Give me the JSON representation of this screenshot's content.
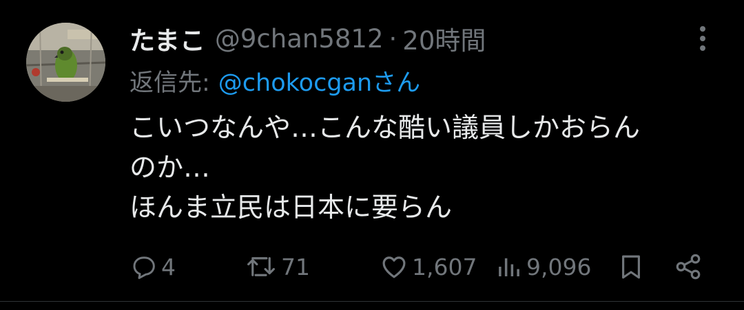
{
  "tweet": {
    "display_name": "たまこ",
    "handle": "@9chan5812",
    "separator": "·",
    "time": "20時間",
    "reply_label": "返信先:",
    "reply_to": "@chokocganさん",
    "body_lines": [
      "こいつなんや…こんな酷い議員しかおらん",
      "のか…",
      "ほんま立民は日本に要らん"
    ]
  },
  "actions": {
    "replies": "4",
    "retweets": "71",
    "likes": "1,607",
    "views": "9,096"
  },
  "icons": {
    "more": "more-horizontal-icon",
    "reply": "reply-bubble-icon",
    "retweet": "retweet-icon",
    "like": "heart-icon",
    "views": "analytics-bars-icon",
    "bookmark": "bookmark-icon",
    "share": "share-icon"
  },
  "colors": {
    "background": "#000000",
    "text_primary": "#e7e9ea",
    "text_secondary": "#71767b",
    "link": "#1d9bf0"
  }
}
